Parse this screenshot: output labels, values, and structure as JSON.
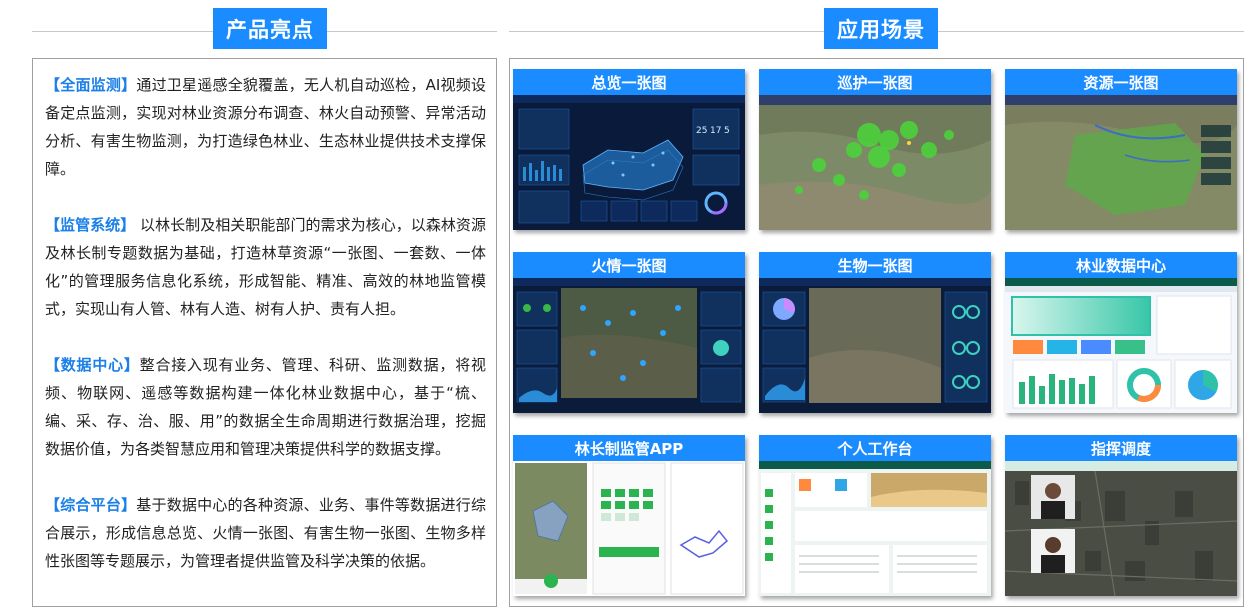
{
  "sections": {
    "product": "产品亮点",
    "scenario": "应用场景"
  },
  "highlights": [
    {
      "tag": "【全面监测】",
      "text": "通过卫星遥感全貌覆盖，无人机自动巡检，AI视频设备定点监测，实现对林业资源分布调查、林火自动预警、异常活动分析、有害生物监测，为打造绿色林业、生态林业提供技术支撑保障。"
    },
    {
      "tag": "【监管系统】",
      "text": " 以林长制及相关职能部门的需求为核心，以森林资源及林长制专题数据为基础，打造林草资源“一张图、一套数、一体化”的管理服务信息化系统，形成智能、精准、高效的林地监管模式，实现山有人管、林有人造、树有人护、责有人担。"
    },
    {
      "tag": "【数据中心】",
      "text": "整合接入现有业务、管理、科研、监测数据，将视频、物联网、遥感等数据构建一体化林业数据中心，基于“梳、编、采、存、治、服、用”的数据全生命周期进行数据治理，挖掘数据价值，为各类智慧应用和管理决策提供科学的数据支撑。"
    },
    {
      "tag": "【综合平台】",
      "text": "基于数据中心的各种资源、业务、事件等数据进行综合展示，形成信息总览、火情一张图、有害生物一张图、生物多样性张图等专题展示，为管理者提供监管及科学决策的依据。"
    }
  ],
  "scenes": [
    {
      "title": "总览一张图",
      "kind": "dashboard"
    },
    {
      "title": "巡护一张图",
      "kind": "map-green"
    },
    {
      "title": "资源一张图",
      "kind": "map-resource"
    },
    {
      "title": "火情一张图",
      "kind": "dashboard-map"
    },
    {
      "title": "生物一张图",
      "kind": "dashboard-map2"
    },
    {
      "title": "林业数据中心",
      "kind": "data-center"
    },
    {
      "title": "林长制监管APP",
      "kind": "app"
    },
    {
      "title": "个人工作台",
      "kind": "workbench"
    },
    {
      "title": "指挥调度",
      "kind": "command"
    }
  ],
  "colors": {
    "accent": "#1a8cff",
    "tag": "#1a7fe8"
  }
}
